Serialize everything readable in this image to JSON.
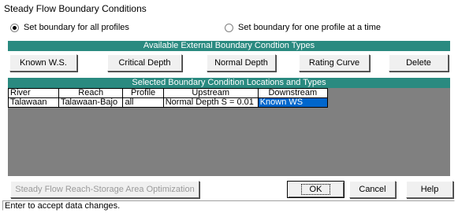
{
  "window": {
    "title": "Steady Flow Boundary Conditions"
  },
  "options": {
    "all_profiles": "Set boundary for all profiles",
    "one_profile": "Set boundary for one profile at a time",
    "selected": "all_profiles"
  },
  "available_band": "Available External Boundary Condtion Types",
  "boundary_buttons": {
    "known_ws": "Known W.S.",
    "critical_depth": "Critical Depth",
    "normal_depth": "Normal Depth",
    "rating_curve": "Rating Curve",
    "delete": "Delete"
  },
  "selected_band": "Selected Boundary Condition Locations and Types",
  "table": {
    "columns": [
      "River",
      "Reach",
      "Profile",
      "Upstream",
      "Downstream"
    ],
    "rows": [
      {
        "river": "Talawaan",
        "reach": "Talawaan-Bajo",
        "profile": "all",
        "upstream": "Normal Depth S = 0.01",
        "downstream": "Known WS"
      }
    ]
  },
  "bottom_buttons": {
    "optimization": "Steady Flow Reach-Storage Area Optimization ...",
    "ok": "OK",
    "cancel": "Cancel",
    "help": "Help"
  },
  "status": "Enter to accept data changes.",
  "colors": {
    "band": "#2a8a80",
    "selection": "#0066cc",
    "grid_bg": "#808080"
  }
}
